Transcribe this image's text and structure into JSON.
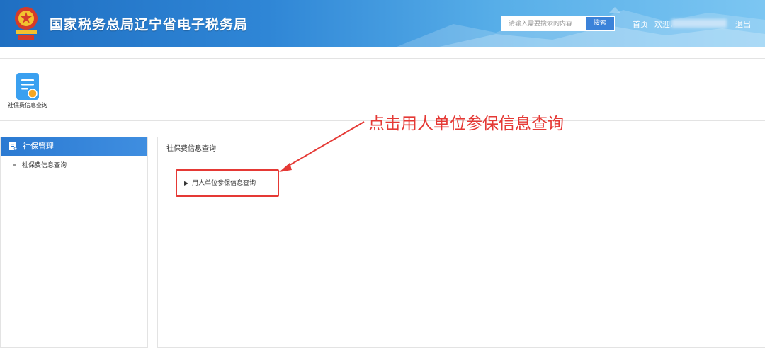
{
  "header": {
    "site_title": "国家税务总局辽宁省电子税务局",
    "search_placeholder": "请输入需要搜索的内容",
    "search_button": "搜索",
    "nav_home": "首页",
    "nav_welcome": "欢迎,",
    "nav_logout": "退出",
    "emblem_icon": "tax-emblem-icon",
    "colors": {
      "header_start": "#1f6fc2",
      "header_end": "#7cc6f2"
    }
  },
  "apps": [
    {
      "label": "社保费信息查询",
      "icon": "document-badge-icon"
    }
  ],
  "sidebar": {
    "header": "社保管理",
    "header_icon": "document-chart-icon",
    "items": [
      {
        "label": "社保费信息查询"
      }
    ]
  },
  "main": {
    "title": "社保费信息查询",
    "tree_items": [
      {
        "label": "用人单位参保信息查询",
        "icon": "triangle-right-icon"
      }
    ]
  },
  "annotation": {
    "text": "点击用人单位参保信息查询",
    "color": "#e53935"
  }
}
